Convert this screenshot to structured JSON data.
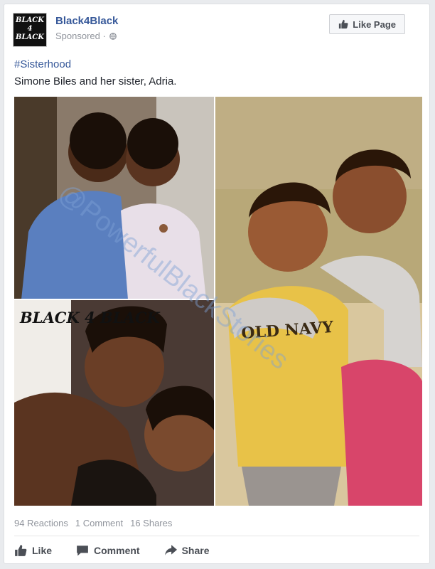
{
  "post": {
    "page_name": "Black4Black",
    "sponsored_label": "Sponsored ·",
    "like_page_label": "Like Page",
    "avatar_logo": "BLACK 4 BLACK",
    "hashtag": "#Sisterhood",
    "caption": "Simone Biles and her sister, Adria."
  },
  "photo": {
    "overlay_logo": "BLACK 4 BLACK",
    "shirt_text": "OLD NAVY",
    "watermark": "@PowerfulBlackStories"
  },
  "stats": {
    "reactions": "94 Reactions",
    "comments": "1 Comment",
    "shares": "16 Shares"
  },
  "actions": {
    "like": "Like",
    "comment": "Comment",
    "share": "Share"
  },
  "colors": {
    "link": "#365899",
    "muted": "#90949c",
    "action_text": "#4b4f56"
  },
  "icons": [
    "globe-icon",
    "thumbs-up-icon",
    "comment-icon",
    "share-icon"
  ]
}
